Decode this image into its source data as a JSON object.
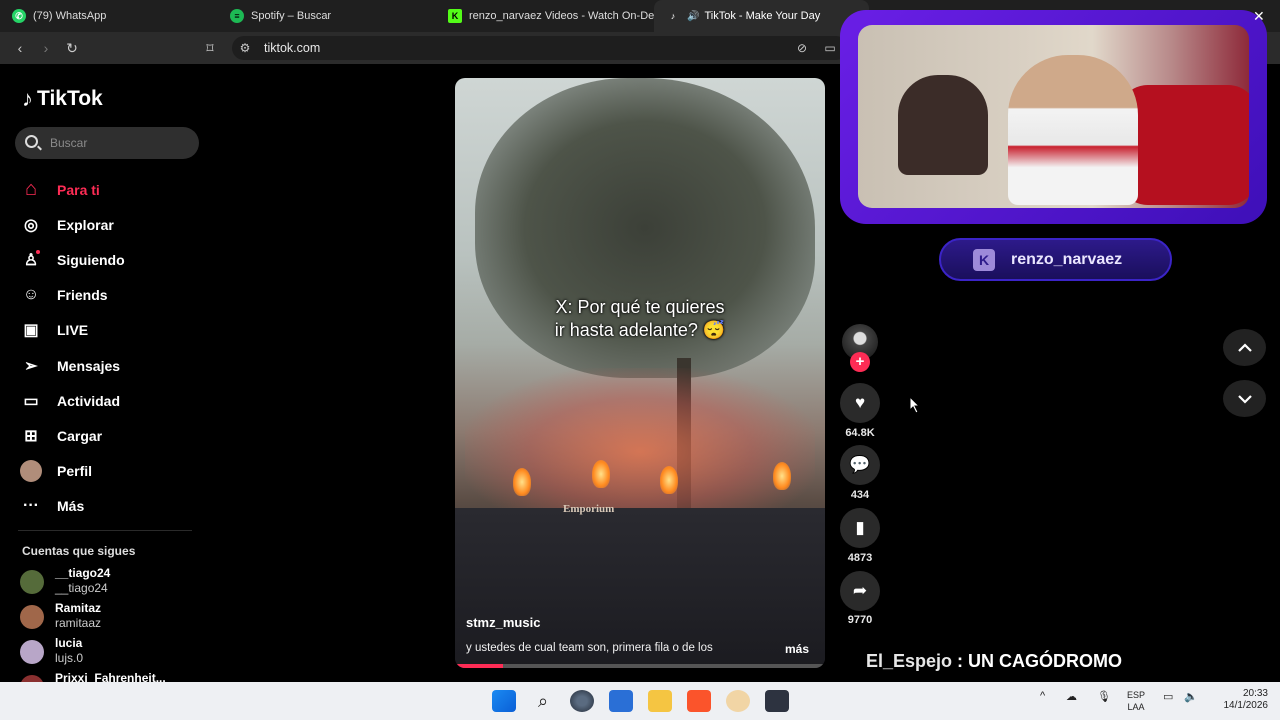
{
  "browser": {
    "tabs": [
      {
        "label": "(79) WhatsApp",
        "icon": "whatsapp-icon",
        "color": "#25d366"
      },
      {
        "label": "Spotify – Buscar",
        "icon": "spotify-icon",
        "color": "#1db954"
      },
      {
        "label": "renzo_narvaez Videos - Watch On-De",
        "icon": "kick-icon",
        "color": "#53fc18"
      },
      {
        "label": "TikTok - Make Your Day",
        "icon": "tiktok-icon",
        "color": "#ffffff"
      }
    ],
    "url": "tiktok.com"
  },
  "sidebar": {
    "logo": "TikTok",
    "search_placeholder": "Buscar",
    "nav": [
      {
        "label": "Para ti",
        "icon": "home-icon",
        "glyph": "⌂"
      },
      {
        "label": "Explorar",
        "icon": "compass-icon",
        "glyph": "◎"
      },
      {
        "label": "Siguiendo",
        "icon": "following-icon",
        "glyph": "♙"
      },
      {
        "label": "Friends",
        "icon": "friends-icon",
        "glyph": "☺"
      },
      {
        "label": "LIVE",
        "icon": "live-icon",
        "glyph": "▣"
      },
      {
        "label": "Mensajes",
        "icon": "messages-icon",
        "glyph": "➢"
      },
      {
        "label": "Actividad",
        "icon": "activity-icon",
        "glyph": "▭"
      },
      {
        "label": "Cargar",
        "icon": "upload-icon",
        "glyph": "⊞"
      },
      {
        "label": "Perfil",
        "icon": "profile-avatar-icon",
        "glyph": "●"
      },
      {
        "label": "Más",
        "icon": "more-icon",
        "glyph": "···"
      }
    ],
    "following_title": "Cuentas que sigues",
    "accounts": [
      {
        "name": "__tiago24",
        "handle": "__tiago24",
        "color": "#556b3a"
      },
      {
        "name": "Ramitaz",
        "handle": "ramitaaz",
        "color": "#a0674a"
      },
      {
        "name": "lucia",
        "handle": "lujs.0",
        "color": "#b8a6c8"
      },
      {
        "name": "Prixxi_Fahrenheit...",
        "handle": "",
        "color": "#8a3030"
      }
    ]
  },
  "video": {
    "caption_line1": "X: Por qué te quieres",
    "caption_line2": "ir hasta adelante? 😴",
    "stage_sign": "Emporium",
    "username": "stmz_music",
    "description": "y ustedes de cual team son, primera fila o de los",
    "more_label": "más",
    "progress": 0.13
  },
  "actions": {
    "likes": "64.8K",
    "comments": "434",
    "saves": "4873",
    "shares": "9770"
  },
  "stream": {
    "streamer": "renzo_narvaez",
    "chat_user": "El_Espejo",
    "chat_message": " : UN CAGÓDROMO"
  },
  "taskbar": {
    "lang1": "ESP",
    "lang2": "LAA",
    "time": "20:33",
    "date": "14/1/2026"
  }
}
